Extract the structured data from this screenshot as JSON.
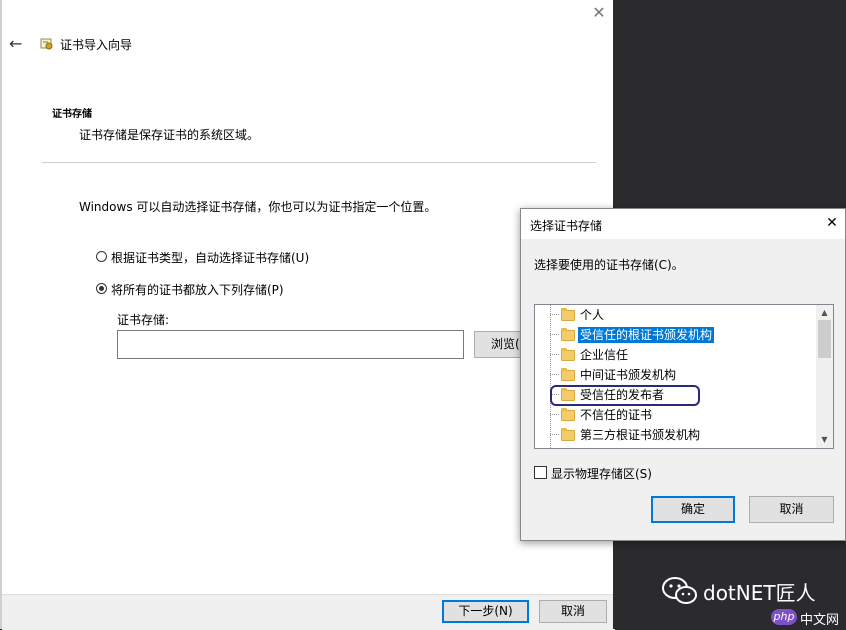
{
  "wizard": {
    "title": "证书导入向导",
    "section_title": "证书存储",
    "section_desc": "证书存储是保存证书的系统区域。",
    "instruction": "Windows 可以自动选择证书存储，你也可以为证书指定一个位置。",
    "option_auto": "根据证书类型，自动选择证书存储(U)",
    "option_manual": "将所有的证书都放入下列存储(P)",
    "store_label": "证书存储:",
    "store_value": "",
    "browse_button": "浏览(R)...",
    "next_button": "下一步(N)",
    "cancel_button": "取消"
  },
  "dialog": {
    "title": "选择证书存储",
    "prompt": "选择要使用的证书存储(C)。",
    "stores": [
      "个人",
      "受信任的根证书颁发机构",
      "企业信任",
      "中间证书颁发机构",
      "受信任的发布者",
      "不信任的证书",
      "第三方根证书颁发机构"
    ],
    "selected_index": 1,
    "circled_index": 4,
    "show_physical_label": "显示物理存储区(S)",
    "ok_button": "确定",
    "cancel_button": "取消"
  },
  "watermark": {
    "brand": "dotNET匠人",
    "site_badge": "php",
    "site_text": "中文网"
  },
  "colors": {
    "selection": "#0078d7",
    "circle": "#2a2a7a",
    "dark_panel": "#2b2b2e"
  }
}
